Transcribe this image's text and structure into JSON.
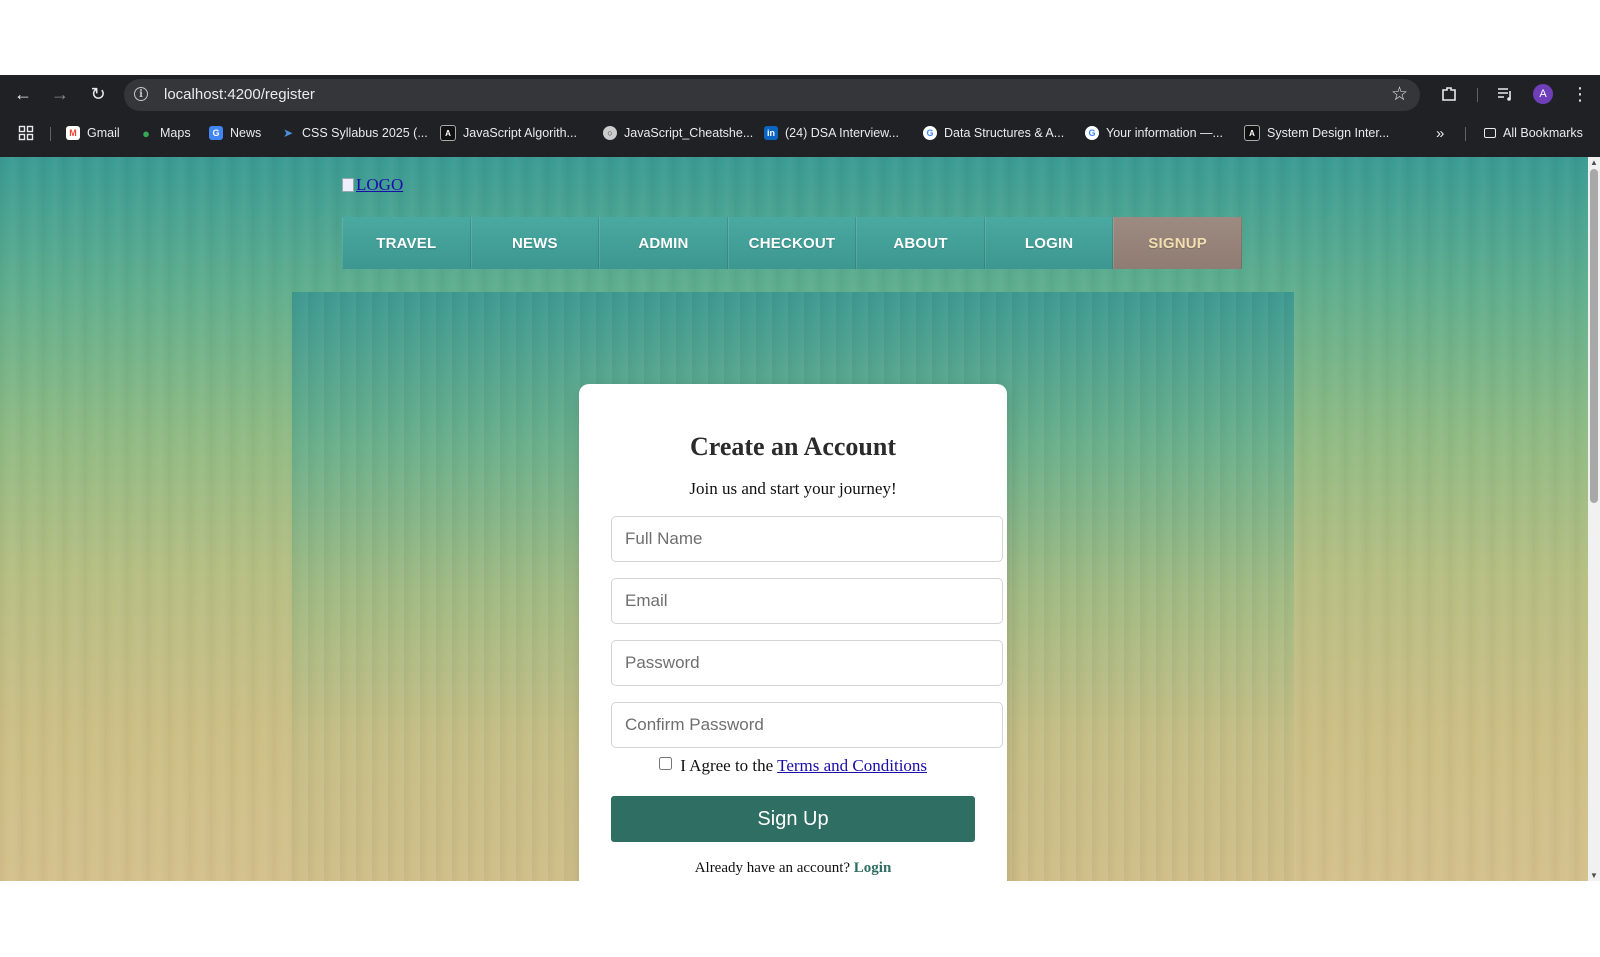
{
  "browser": {
    "url": "localhost:4200/register",
    "profile_initial": "A",
    "bookmarks": [
      {
        "label": "Gmail",
        "icon": "gmail-icon"
      },
      {
        "label": "Maps",
        "icon": "maps-icon"
      },
      {
        "label": "News",
        "icon": "news-icon"
      },
      {
        "label": "CSS Syllabus 2025 (...",
        "icon": "css-icon"
      },
      {
        "label": "JavaScript Algorith...",
        "icon": "js-algo-icon"
      },
      {
        "label": "JavaScript_Cheatshe...",
        "icon": "globe-icon"
      },
      {
        "label": "(24) DSA Interview...",
        "icon": "linkedin-icon"
      },
      {
        "label": "Data Structures & A...",
        "icon": "google-icon"
      },
      {
        "label": "Your information —...",
        "icon": "google-icon"
      },
      {
        "label": "System Design Inter...",
        "icon": "sysdesign-icon"
      }
    ],
    "all_bookmarks_label": "All Bookmarks"
  },
  "site": {
    "logo_alt": "LOGO",
    "nav": [
      "TRAVEL",
      "NEWS",
      "ADMIN",
      "CHECKOUT",
      "ABOUT",
      "LOGIN",
      "SIGNUP"
    ],
    "active_nav": "SIGNUP"
  },
  "form": {
    "title": "Create an Account",
    "subtitle": "Join us and start your journey!",
    "full_name_placeholder": "Full Name",
    "email_placeholder": "Email",
    "password_placeholder": "Password",
    "confirm_password_placeholder": "Confirm Password",
    "agree_text": "I Agree to the",
    "terms_link": "Terms and Conditions",
    "submit_label": "Sign Up",
    "already_text": "Already have an account?",
    "login_link": "Login"
  },
  "colors": {
    "chrome_bg": "#202124",
    "nav_bg": "#3c9790",
    "nav_active_bg": "#8f7c72",
    "button_bg": "#2f6e63"
  }
}
